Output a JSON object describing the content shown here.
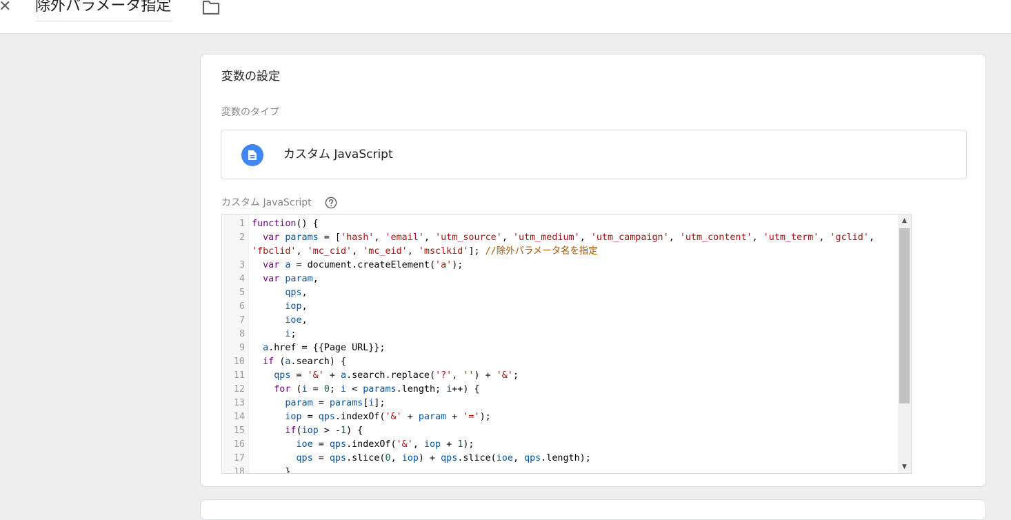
{
  "header": {
    "close_glyph": "✕",
    "title": "除外パラメータ指定"
  },
  "card": {
    "title": "変数の設定",
    "type_label": "変数のタイプ",
    "type_name": "カスタム JavaScript",
    "code_label": "カスタム JavaScript"
  },
  "editor": {
    "lines": [
      {
        "num": "1",
        "tokens": [
          [
            "k",
            "function"
          ],
          [
            "t",
            "() {"
          ]
        ]
      },
      {
        "num": "2",
        "tokens": [
          [
            "t",
            "  "
          ],
          [
            "k",
            "var"
          ],
          [
            "t",
            " "
          ],
          [
            "v",
            "params"
          ],
          [
            "t",
            " = ["
          ],
          [
            "s",
            "'hash'"
          ],
          [
            "t",
            ", "
          ],
          [
            "s",
            "'email'"
          ],
          [
            "t",
            ", "
          ],
          [
            "s",
            "'utm_source'"
          ],
          [
            "t",
            ", "
          ],
          [
            "s",
            "'utm_medium'"
          ],
          [
            "t",
            ", "
          ],
          [
            "s",
            "'utm_campaign'"
          ],
          [
            "t",
            ", "
          ],
          [
            "s",
            "'utm_content'"
          ],
          [
            "t",
            ", "
          ],
          [
            "s",
            "'utm_term'"
          ],
          [
            "t",
            ", "
          ],
          [
            "s",
            "'gclid'"
          ],
          [
            "t",
            ", "
          ],
          [
            "s",
            "'fbclid'"
          ],
          [
            "t",
            ", "
          ],
          [
            "s",
            "'mc_cid'"
          ],
          [
            "t",
            ", "
          ],
          [
            "s",
            "'mc_eid'"
          ],
          [
            "t",
            ", "
          ],
          [
            "s",
            "'msclkid'"
          ],
          [
            "t",
            "]; "
          ],
          [
            "c",
            "//除外パラメータ名を指定"
          ]
        ],
        "wrap": true
      },
      {
        "num": "3",
        "tokens": [
          [
            "t",
            "  "
          ],
          [
            "k",
            "var"
          ],
          [
            "t",
            " "
          ],
          [
            "v",
            "a"
          ],
          [
            "t",
            " = document.createElement("
          ],
          [
            "s",
            "'a'"
          ],
          [
            "t",
            ");"
          ]
        ]
      },
      {
        "num": "4",
        "tokens": [
          [
            "t",
            "  "
          ],
          [
            "k",
            "var"
          ],
          [
            "t",
            " "
          ],
          [
            "v",
            "param"
          ],
          [
            "t",
            ","
          ]
        ]
      },
      {
        "num": "5",
        "tokens": [
          [
            "t",
            "      "
          ],
          [
            "v",
            "qps"
          ],
          [
            "t",
            ","
          ]
        ]
      },
      {
        "num": "6",
        "tokens": [
          [
            "t",
            "      "
          ],
          [
            "v",
            "iop"
          ],
          [
            "t",
            ","
          ]
        ]
      },
      {
        "num": "7",
        "tokens": [
          [
            "t",
            "      "
          ],
          [
            "v",
            "ioe"
          ],
          [
            "t",
            ","
          ]
        ]
      },
      {
        "num": "8",
        "tokens": [
          [
            "t",
            "      "
          ],
          [
            "v",
            "i"
          ],
          [
            "t",
            ";"
          ]
        ]
      },
      {
        "num": "9",
        "tokens": [
          [
            "t",
            "  "
          ],
          [
            "v",
            "a"
          ],
          [
            "t",
            ".href = {{Page URL}};"
          ]
        ]
      },
      {
        "num": "10",
        "tokens": [
          [
            "t",
            "  "
          ],
          [
            "k",
            "if"
          ],
          [
            "t",
            " ("
          ],
          [
            "v",
            "a"
          ],
          [
            "t",
            ".search) {"
          ]
        ]
      },
      {
        "num": "11",
        "tokens": [
          [
            "t",
            "    "
          ],
          [
            "v",
            "qps"
          ],
          [
            "t",
            " = "
          ],
          [
            "s",
            "'&'"
          ],
          [
            "t",
            " + "
          ],
          [
            "v",
            "a"
          ],
          [
            "t",
            ".search.replace("
          ],
          [
            "s",
            "'?'"
          ],
          [
            "t",
            ", "
          ],
          [
            "s",
            "''"
          ],
          [
            "t",
            ") + "
          ],
          [
            "s",
            "'&'"
          ],
          [
            "t",
            ";"
          ]
        ]
      },
      {
        "num": "12",
        "tokens": [
          [
            "t",
            "    "
          ],
          [
            "k",
            "for"
          ],
          [
            "t",
            " ("
          ],
          [
            "v",
            "i"
          ],
          [
            "t",
            " = "
          ],
          [
            "n",
            "0"
          ],
          [
            "t",
            "; "
          ],
          [
            "v",
            "i"
          ],
          [
            "t",
            " < "
          ],
          [
            "v",
            "params"
          ],
          [
            "t",
            ".length; "
          ],
          [
            "v",
            "i"
          ],
          [
            "t",
            "++) {"
          ]
        ]
      },
      {
        "num": "13",
        "tokens": [
          [
            "t",
            "      "
          ],
          [
            "v",
            "param"
          ],
          [
            "t",
            " = "
          ],
          [
            "v",
            "params"
          ],
          [
            "t",
            "["
          ],
          [
            "v",
            "i"
          ],
          [
            "t",
            "];"
          ]
        ]
      },
      {
        "num": "14",
        "tokens": [
          [
            "t",
            "      "
          ],
          [
            "v",
            "iop"
          ],
          [
            "t",
            " = "
          ],
          [
            "v",
            "qps"
          ],
          [
            "t",
            ".indexOf("
          ],
          [
            "s",
            "'&'"
          ],
          [
            "t",
            " + "
          ],
          [
            "v",
            "param"
          ],
          [
            "t",
            " + "
          ],
          [
            "s",
            "'='"
          ],
          [
            "t",
            ");"
          ]
        ]
      },
      {
        "num": "15",
        "tokens": [
          [
            "t",
            "      "
          ],
          [
            "k",
            "if"
          ],
          [
            "t",
            "("
          ],
          [
            "v",
            "iop"
          ],
          [
            "t",
            " > -"
          ],
          [
            "n",
            "1"
          ],
          [
            "t",
            ") {"
          ]
        ]
      },
      {
        "num": "16",
        "tokens": [
          [
            "t",
            "        "
          ],
          [
            "v",
            "ioe"
          ],
          [
            "t",
            " = "
          ],
          [
            "v",
            "qps"
          ],
          [
            "t",
            ".indexOf("
          ],
          [
            "s",
            "'&'"
          ],
          [
            "t",
            ", "
          ],
          [
            "v",
            "iop"
          ],
          [
            "t",
            " + "
          ],
          [
            "n",
            "1"
          ],
          [
            "t",
            ");"
          ]
        ]
      },
      {
        "num": "17",
        "tokens": [
          [
            "t",
            "        "
          ],
          [
            "v",
            "qps"
          ],
          [
            "t",
            " = "
          ],
          [
            "v",
            "qps"
          ],
          [
            "t",
            ".slice("
          ],
          [
            "n",
            "0"
          ],
          [
            "t",
            ", "
          ],
          [
            "v",
            "iop"
          ],
          [
            "t",
            ") + "
          ],
          [
            "v",
            "qps"
          ],
          [
            "t",
            ".slice("
          ],
          [
            "v",
            "ioe"
          ],
          [
            "t",
            ", "
          ],
          [
            "v",
            "qps"
          ],
          [
            "t",
            ".length);"
          ]
        ]
      },
      {
        "num": "18",
        "tokens": [
          [
            "t",
            "      }"
          ]
        ]
      }
    ]
  },
  "colors": {
    "accent": "#4285f4",
    "keyword": "#770088",
    "variable": "#0055aa",
    "string": "#aa1111",
    "comment": "#aa5500",
    "number": "#116644"
  },
  "icons": {
    "close": "close-icon",
    "folder": "folder-icon",
    "type": "document-icon",
    "help": "help-icon"
  }
}
